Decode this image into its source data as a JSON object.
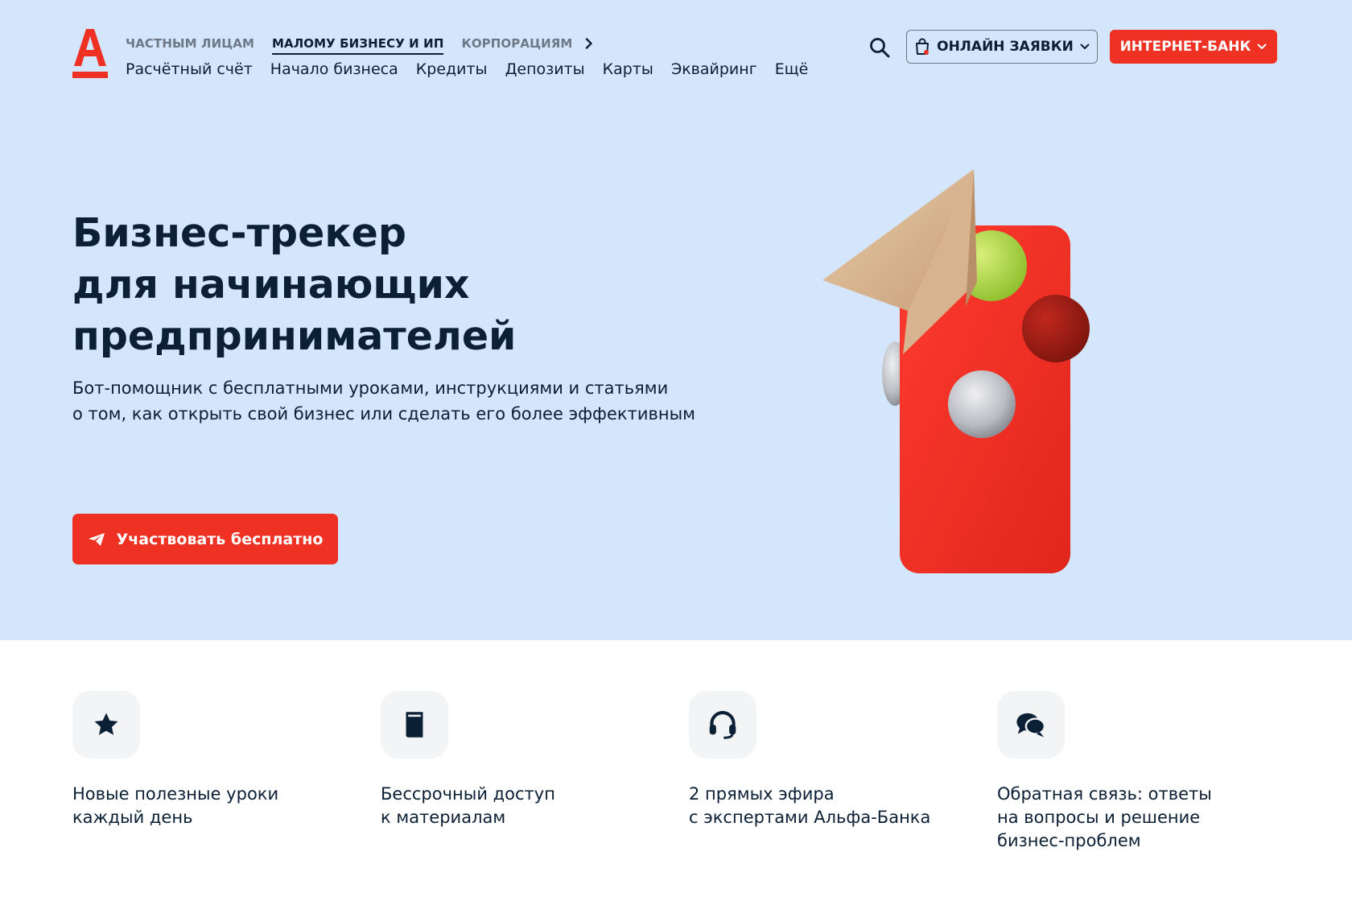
{
  "brand": {
    "accent_color": "#ef3124",
    "hero_bg": "#d3e6fb",
    "logo_icon": "alfa-logo-icon"
  },
  "header": {
    "segments": [
      {
        "label": "ЧАСТНЫМ ЛИЦАМ",
        "active": false
      },
      {
        "label": "МАЛОМУ БИЗНЕСУ И ИП",
        "active": true
      },
      {
        "label": "КОРПОРАЦИЯМ",
        "active": false
      }
    ],
    "segment_arrow_icon": "chevron-right-icon",
    "menu": [
      "Расчётный счёт",
      "Начало бизнеса",
      "Кредиты",
      "Депозиты",
      "Карты",
      "Эквайринг",
      "Ещё"
    ],
    "search_icon": "search-icon",
    "apps_button": {
      "label": "ОНЛАЙН ЗАЯВКИ",
      "icon": "shopping-bag-icon",
      "chevron": "chevron-down-icon"
    },
    "bank_button": {
      "label": "ИНТЕРНЕТ-БАНК",
      "chevron": "chevron-down-icon"
    }
  },
  "hero": {
    "title_lines": [
      "Бизнес-трекер",
      "для начинающих",
      "предпринимателей"
    ],
    "subtitle_lines": [
      "Бот-помощник с бесплатными уроками, инструкциями и статьями",
      "о том, как открыть свой бизнес или сделать его более эффективным"
    ],
    "cta": {
      "label": "Участвовать бесплатно",
      "icon": "telegram-plane-icon"
    },
    "illustration": "phone-with-paper-plane-illustration"
  },
  "features": [
    {
      "icon": "star-icon",
      "lines": [
        "Новые полезные уроки",
        "каждый день"
      ]
    },
    {
      "icon": "book-icon",
      "lines": [
        "Бессрочный доступ",
        "к материалам"
      ]
    },
    {
      "icon": "headset-icon",
      "lines": [
        "2 прямых эфира",
        "с экспертами Альфа-Банка"
      ]
    },
    {
      "icon": "chat-bubbles-icon",
      "lines": [
        "Обратная связь: ответы",
        "на вопросы и решение",
        "бизнес-проблем"
      ]
    }
  ]
}
